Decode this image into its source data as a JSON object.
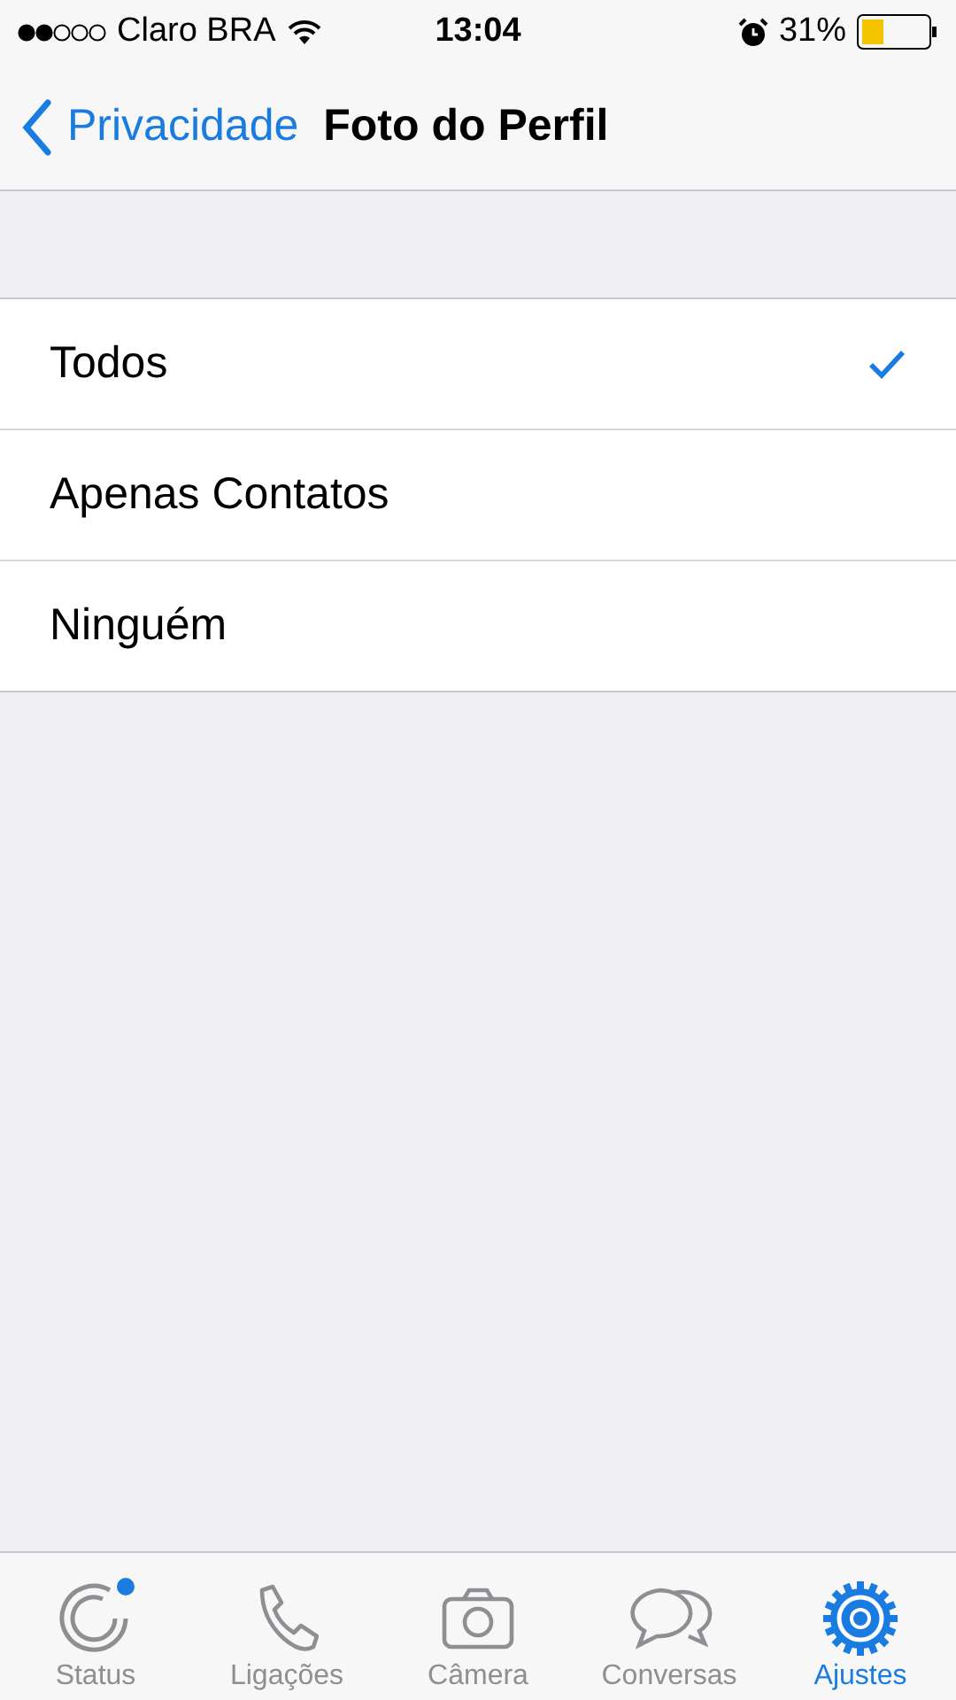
{
  "status_bar": {
    "carrier": "Claro BRA",
    "time": "13:04",
    "battery": "31%"
  },
  "nav": {
    "back": "Privacidade",
    "title": "Foto do Perfil"
  },
  "options": [
    {
      "label": "Todos",
      "selected": true
    },
    {
      "label": "Apenas Contatos",
      "selected": false
    },
    {
      "label": "Ninguém",
      "selected": false
    }
  ],
  "tabs": [
    {
      "kind": "status",
      "label": "Status",
      "selected": false,
      "dot": true
    },
    {
      "kind": "calls",
      "label": "Ligações",
      "selected": false,
      "dot": false
    },
    {
      "kind": "camera",
      "label": "Câmera",
      "selected": false,
      "dot": false
    },
    {
      "kind": "chats",
      "label": "Conversas",
      "selected": false,
      "dot": false
    },
    {
      "kind": "settings",
      "label": "Ajustes",
      "selected": true,
      "dot": false
    }
  ]
}
